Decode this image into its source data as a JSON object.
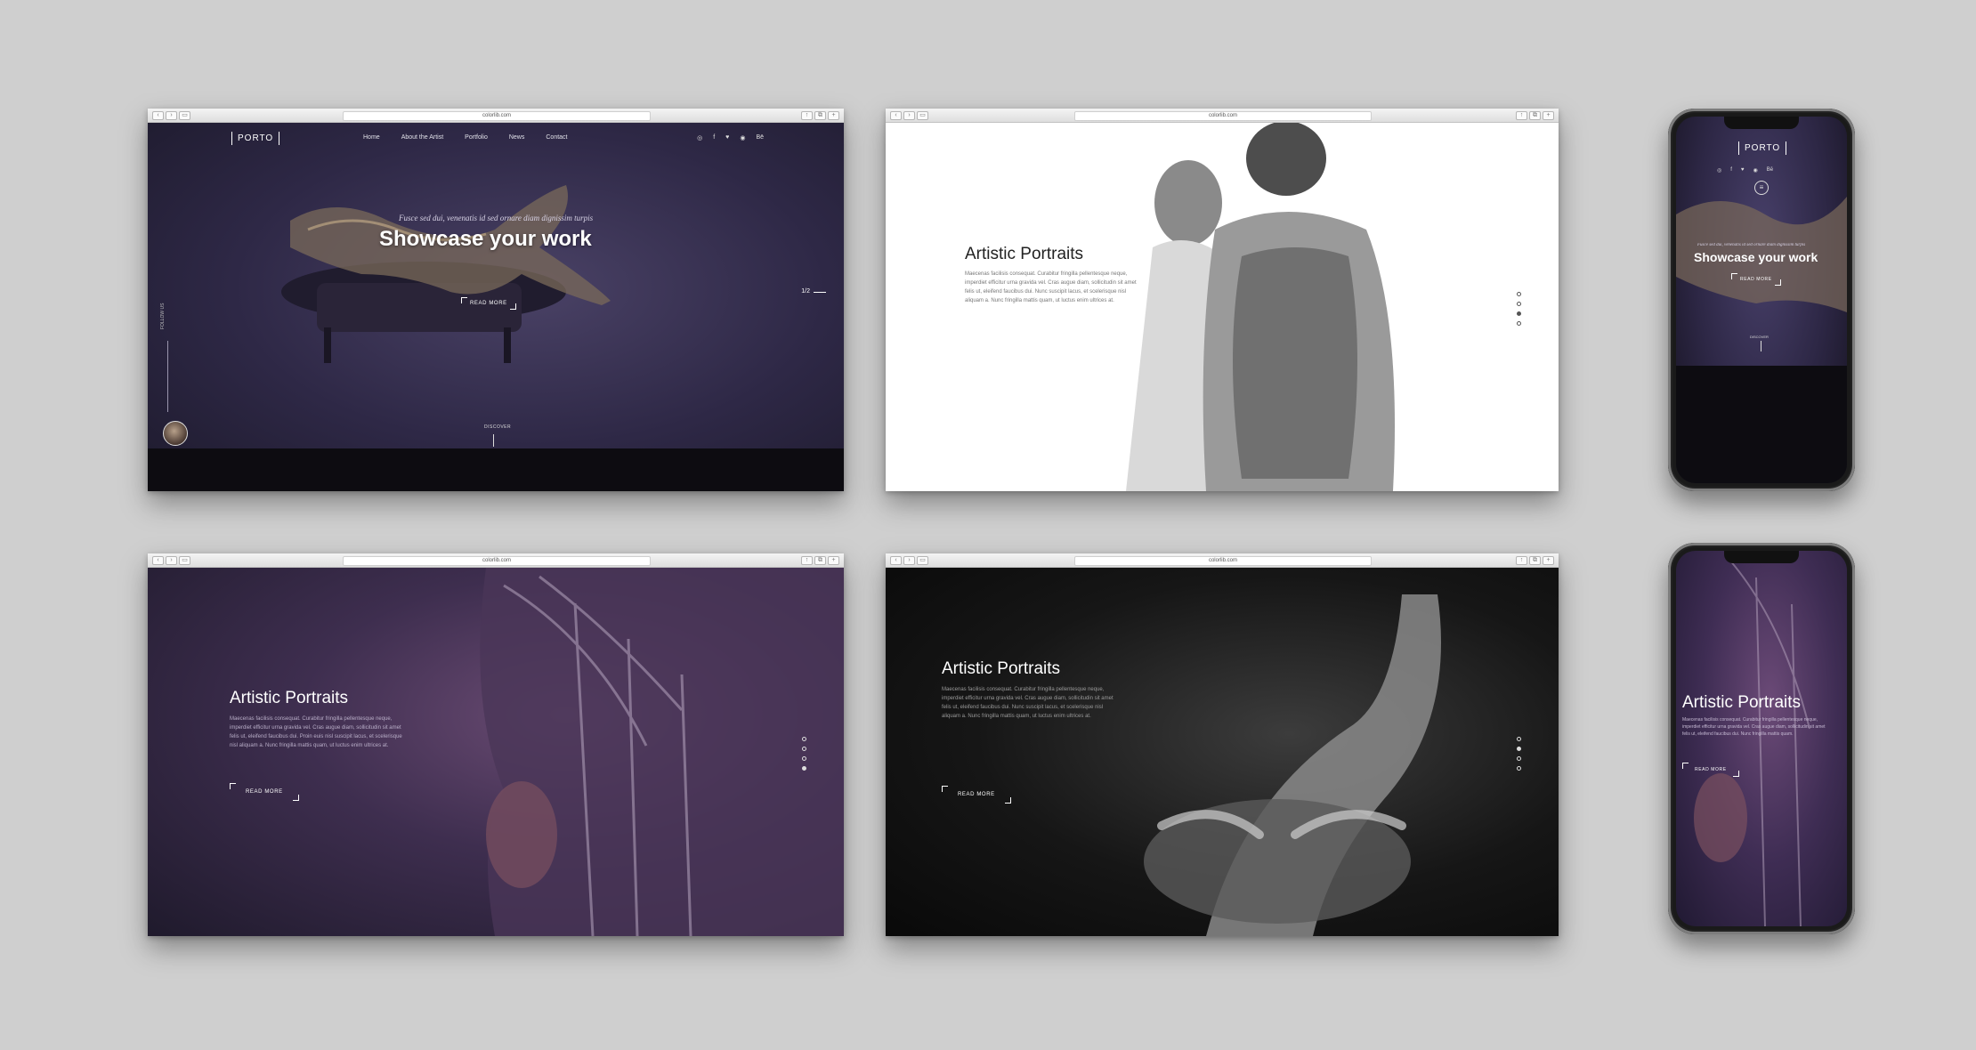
{
  "browser": {
    "url": "colorlib.com"
  },
  "screen1": {
    "logo": "PORTO",
    "nav": [
      "Home",
      "About the Artist",
      "Portfolio",
      "News",
      "Contact"
    ],
    "socials": [
      "◎",
      "f",
      "♥",
      "◉",
      "Bē"
    ],
    "script_text": "Fusce sed dui, venenatis id sed ornare diam dignissim turpis",
    "title": "Showcase your work",
    "cta": "READ MORE",
    "pager": "1/2",
    "side_label": "FOLLOW US",
    "discover": "DISCOVER"
  },
  "screen2": {
    "title": "Artistic Portraits",
    "paragraph": "Maecenas facilisis consequat. Curabitur fringilla pellentesque neque, imperdiet efficitur urna gravida vel. Cras augue diam, sollicitudin sit amet felis ut, eleifend faucibus dui. Nunc suscipit lacus, et scelerisque nisl aliquam a. Nunc fringilla mattis quam, ut luctus enim ultrices at.",
    "dots": [
      false,
      false,
      true,
      false
    ]
  },
  "screen3": {
    "title": "Artistic Portraits",
    "paragraph": "Maecenas facilisis consequat. Curabitur fringilla pellentesque neque, imperdiet efficitur urna gravida vel. Cras augue diam, sollicitudin sit amet felis ut, eleifend faucibus dui. Proin euis nisl suscipit lacus, et scelerisque nisl aliquam a. Nunc fringilla mattis quam, ut luctus enim ultrices at.",
    "cta": "READ MORE",
    "dots": [
      false,
      false,
      false,
      true
    ]
  },
  "screen4": {
    "title": "Artistic Portraits",
    "paragraph": "Maecenas facilisis consequat. Curabitur fringilla pellentesque neque, imperdiet efficitur urna gravida vel. Cras augue diam, sollicitudin sit amet felis ut, eleifend faucibus dui. Nunc suscipit lacus, et scelerisque nisl aliquam a. Nunc fringilla mattis quam, ut luctus enim ultrices at.",
    "cta": "READ MORE",
    "dots": [
      false,
      true,
      false,
      false
    ]
  },
  "phone1": {
    "logo": "PORTO",
    "script_text": "Fusce sed dui, venenatis id sed ornare diam dignissim turpis",
    "title": "Showcase your work",
    "cta": "READ MORE",
    "discover": "DISCOVER"
  },
  "phone2": {
    "title": "Artistic Portraits",
    "paragraph": "Maecenas facilisis consequat. Curabitur fringilla pellentesque neque, imperdiet efficitur urna gravida vel. Cras augue diam, sollicitudin sit amet felis ut, eleifend faucibus dui. Nunc fringilla mattis quam.",
    "cta": "READ MORE"
  }
}
